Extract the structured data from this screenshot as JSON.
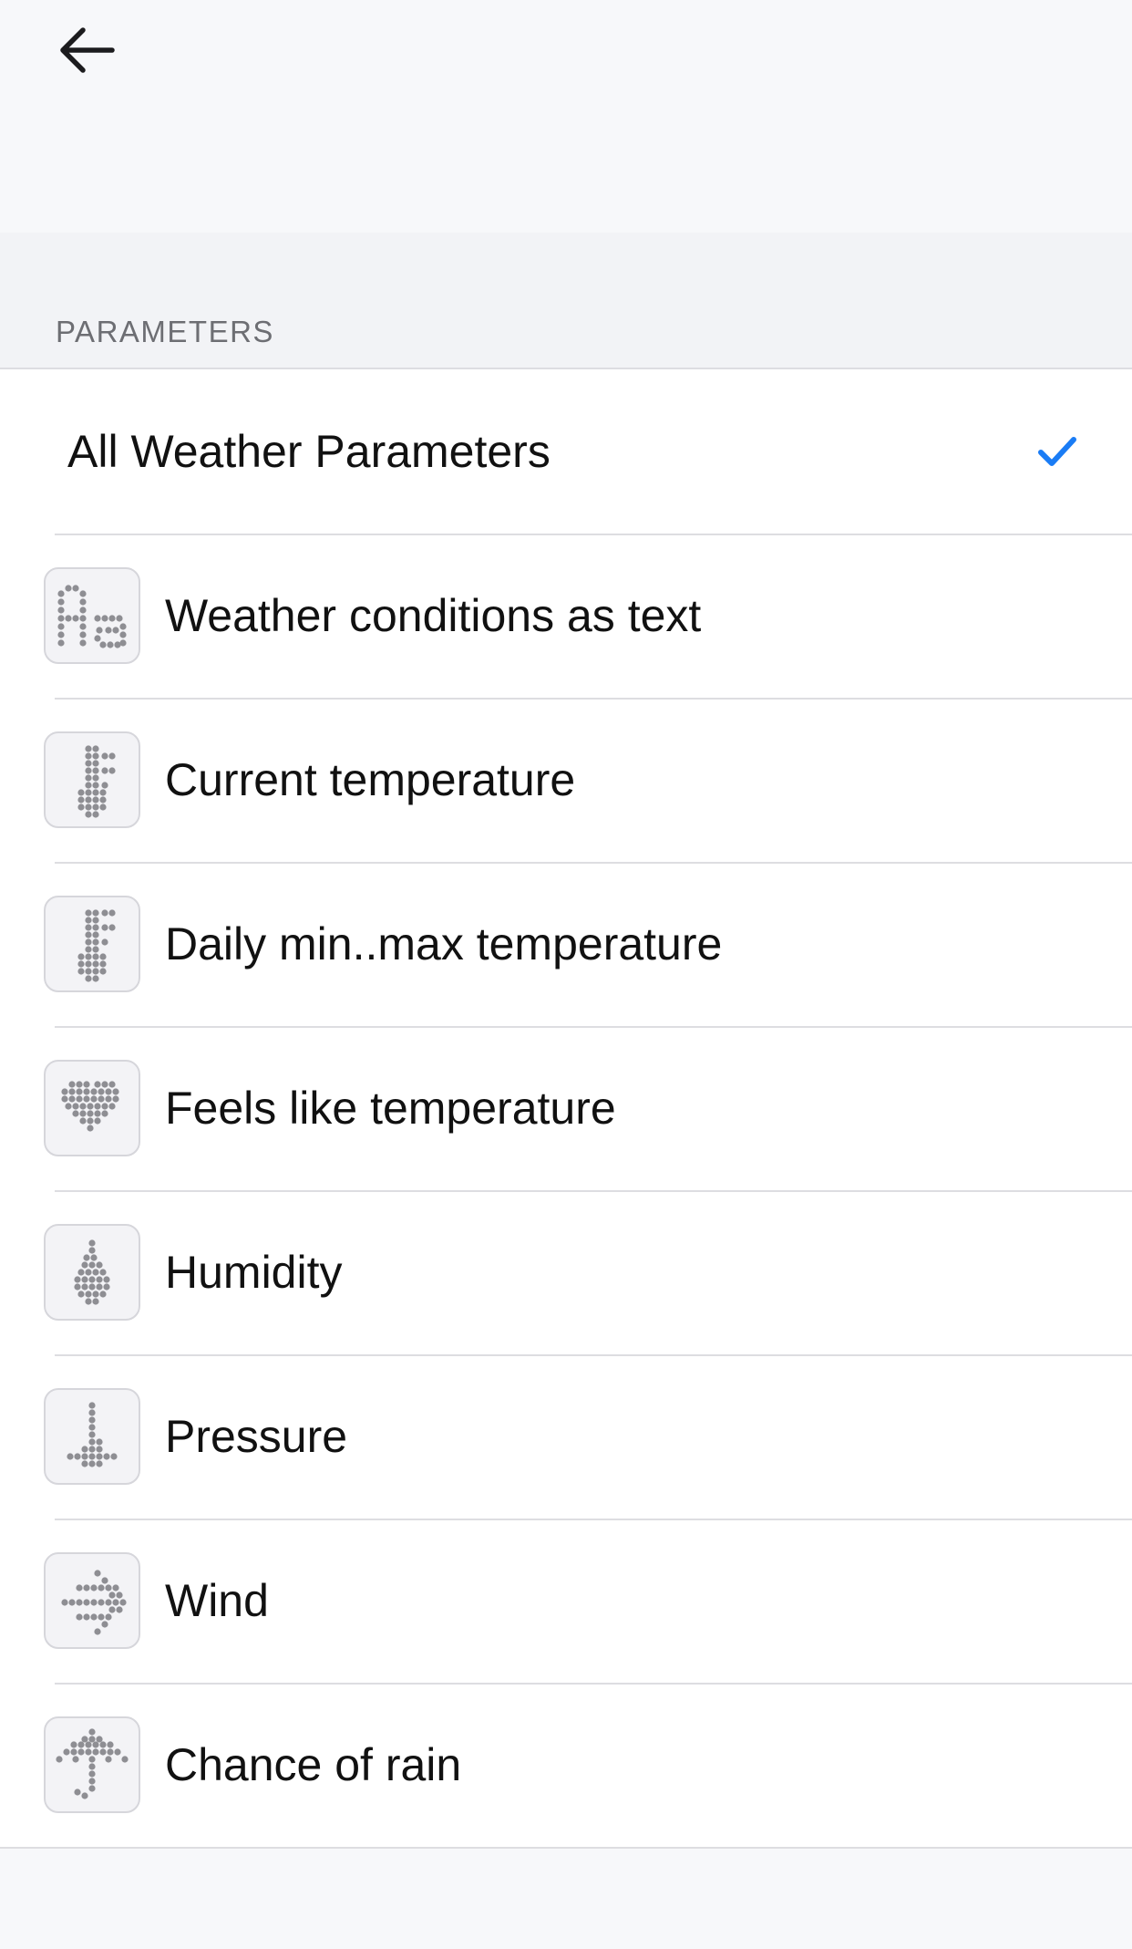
{
  "nav": {
    "back_icon": "arrow-left-icon"
  },
  "section": {
    "header": "PARAMETERS"
  },
  "list": {
    "all": {
      "label": "All Weather Parameters",
      "selected": true,
      "check_icon": "checkmark-icon",
      "check_color": "#1a7cf5"
    },
    "items": [
      {
        "label": "Weather conditions as text",
        "icon": "text-aa-dot-icon"
      },
      {
        "label": "Current temperature",
        "icon": "thermometer-dot-icon"
      },
      {
        "label": "Daily min..max temperature",
        "icon": "thermometer-range-dot-icon"
      },
      {
        "label": "Feels like temperature",
        "icon": "heart-dot-icon"
      },
      {
        "label": "Humidity",
        "icon": "droplet-dot-icon"
      },
      {
        "label": "Pressure",
        "icon": "gauge-dot-icon"
      },
      {
        "label": "Wind",
        "icon": "wind-arrow-dot-icon"
      },
      {
        "label": "Chance of rain",
        "icon": "umbrella-dot-icon"
      }
    ]
  }
}
